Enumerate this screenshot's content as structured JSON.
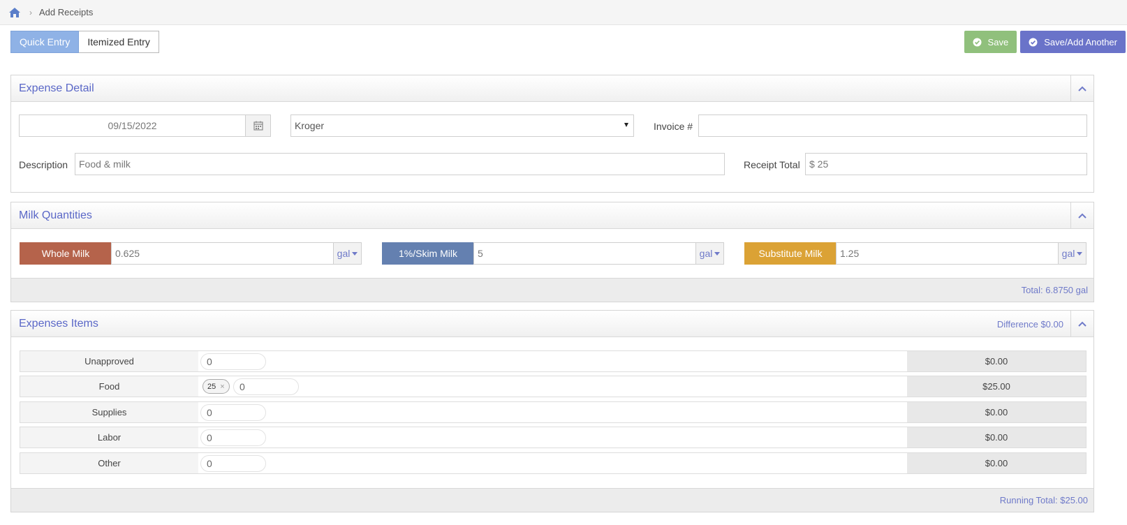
{
  "breadcrumb": {
    "home_icon": "home-icon",
    "current": "Add Receipts"
  },
  "entry_tabs": [
    {
      "label": "Quick Entry",
      "active": true
    },
    {
      "label": "Itemized Entry",
      "active": false
    }
  ],
  "actions": {
    "save_label": "Save",
    "save_add_label": "Save/Add Another"
  },
  "expense_detail": {
    "title": "Expense Detail",
    "date_value": "09/15/2022",
    "vendor_selected": "Kroger",
    "invoice_label": "Invoice #",
    "invoice_value": "",
    "description_label": "Description",
    "description_value": "Food & milk",
    "receipt_total_label": "Receipt Total",
    "receipt_total_value": "$ 25"
  },
  "milk": {
    "title": "Milk Quantities",
    "groups": [
      {
        "label": "Whole Milk",
        "value": "0.625",
        "unit": "gal",
        "color": "#b5634b"
      },
      {
        "label": "1%/Skim Milk",
        "value": "5",
        "unit": "gal",
        "color": "#6480b0"
      },
      {
        "label": "Substitute Milk",
        "value": "1.25",
        "unit": "gal",
        "color": "#dba235"
      }
    ],
    "total": "Total: 6.8750 gal"
  },
  "expenses": {
    "title": "Expenses Items",
    "difference": "Difference $0.00",
    "rows": [
      {
        "category": "Unapproved",
        "input": "0",
        "amount": "$0.00"
      },
      {
        "category": "Food",
        "chip": "25",
        "chip_remove": "×",
        "input": "0",
        "amount": "$25.00"
      },
      {
        "category": "Supplies",
        "input": "0",
        "amount": "$0.00"
      },
      {
        "category": "Labor",
        "input": "0",
        "amount": "$0.00"
      },
      {
        "category": "Other",
        "input": "0",
        "amount": "$0.00"
      }
    ],
    "running_total": "Running Total: $25.00"
  },
  "colors": {
    "accent": "#5a67c7",
    "save": "#90c07c",
    "save_add": "#6a73c9",
    "tab_active": "#8fb2e6"
  }
}
